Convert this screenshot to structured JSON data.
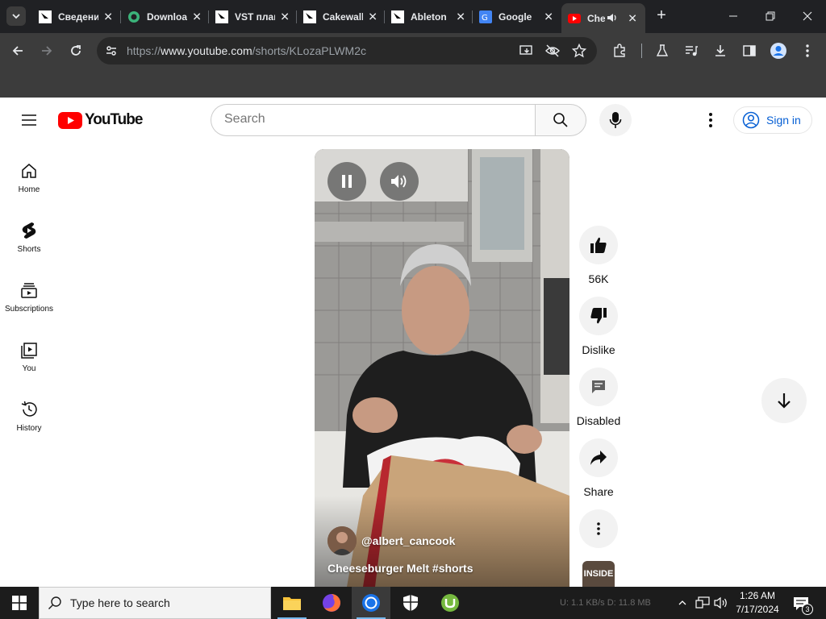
{
  "browser": {
    "tabs": [
      {
        "title": "Сведения",
        "icon": "generic-tool-icon"
      },
      {
        "title": "Download",
        "icon": "download-site-icon"
      },
      {
        "title": "VST плагины",
        "icon": "generic-tool-icon"
      },
      {
        "title": "Cakewalk",
        "icon": "generic-tool-icon"
      },
      {
        "title": "Ableton",
        "icon": "generic-tool-icon"
      },
      {
        "title": "Google",
        "icon": "google-translate-icon"
      },
      {
        "title": "Cheeseburger Melt",
        "icon": "youtube-icon",
        "active": true
      }
    ],
    "new_tab": "+",
    "url_prefix": "https://",
    "url_host": "www.youtube.com",
    "url_path": "/shorts/KLozaPLWM2c"
  },
  "youtube": {
    "logo_text": "YouTube",
    "search_placeholder": "Search",
    "sign_in": "Sign in",
    "guide": [
      {
        "label": "Home",
        "icon": "home-icon"
      },
      {
        "label": "Shorts",
        "icon": "shorts-icon"
      },
      {
        "label": "Subscriptions",
        "icon": "subscriptions-icon"
      },
      {
        "label": "You",
        "icon": "you-library-icon"
      },
      {
        "label": "History",
        "icon": "history-icon"
      }
    ],
    "short": {
      "channel": "@albert_cancook",
      "title": "Cheeseburger Melt #shorts"
    },
    "actions": {
      "like": "56K",
      "dislike": "Dislike",
      "comments": "Disabled",
      "share": "Share"
    },
    "sound_thumb_text": "INSIDE"
  },
  "taskbar": {
    "search_placeholder": "Type here to search",
    "net_status": "U: 1.1 KB/s  D: 11.8 MB",
    "time": "1:26 AM",
    "date": "7/17/2024",
    "notification_count": "3"
  },
  "colors": {
    "youtube_red": "#ff0000",
    "link_blue": "#065fd4",
    "chrome_dark": "#202124",
    "taskbar": "#1c1c1c"
  }
}
